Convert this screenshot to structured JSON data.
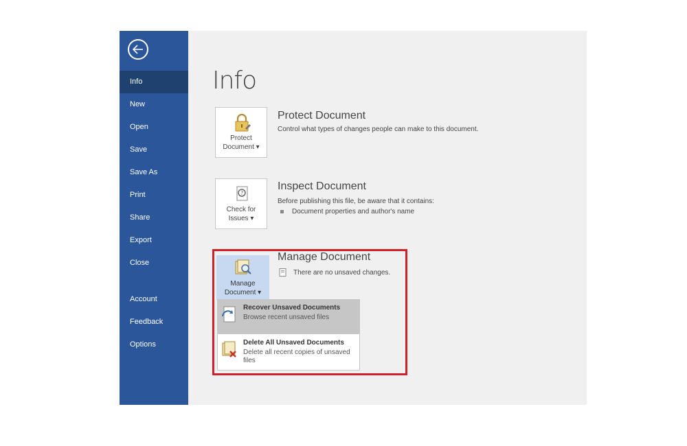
{
  "sidebar": {
    "items": [
      {
        "label": "Info"
      },
      {
        "label": "New"
      },
      {
        "label": "Open"
      },
      {
        "label": "Save"
      },
      {
        "label": "Save As"
      },
      {
        "label": "Print"
      },
      {
        "label": "Share"
      },
      {
        "label": "Export"
      },
      {
        "label": "Close"
      },
      {
        "label": "Account"
      },
      {
        "label": "Feedback"
      },
      {
        "label": "Options"
      }
    ],
    "active": "Info"
  },
  "page": {
    "title": "Info"
  },
  "protect": {
    "button_line1": "Protect",
    "button_line2": "Document ▾",
    "title": "Protect Document",
    "description": "Control what types of changes people can make to this document."
  },
  "inspect": {
    "button_line1": "Check for",
    "button_line2": "Issues ▾",
    "title": "Inspect Document",
    "description": "Before publishing this file, be aware that it contains:",
    "bullets": [
      "Document properties and author's name"
    ]
  },
  "manage": {
    "button_line1": "Manage",
    "button_line2": "Document ▾",
    "title": "Manage Document",
    "status": "There are no unsaved changes.",
    "menu": [
      {
        "title": "Recover Unsaved Documents",
        "desc": "Browse recent unsaved files",
        "icon": "recover-document-icon"
      },
      {
        "title": "Delete All Unsaved Documents",
        "desc": "Delete all recent copies of unsaved files",
        "icon": "delete-document-icon"
      }
    ]
  },
  "colors": {
    "sidebar": "#2b579a",
    "sidebar_active": "#1e4170",
    "highlight_border": "#d0202a",
    "manage_tile": "#c6d9f1"
  }
}
